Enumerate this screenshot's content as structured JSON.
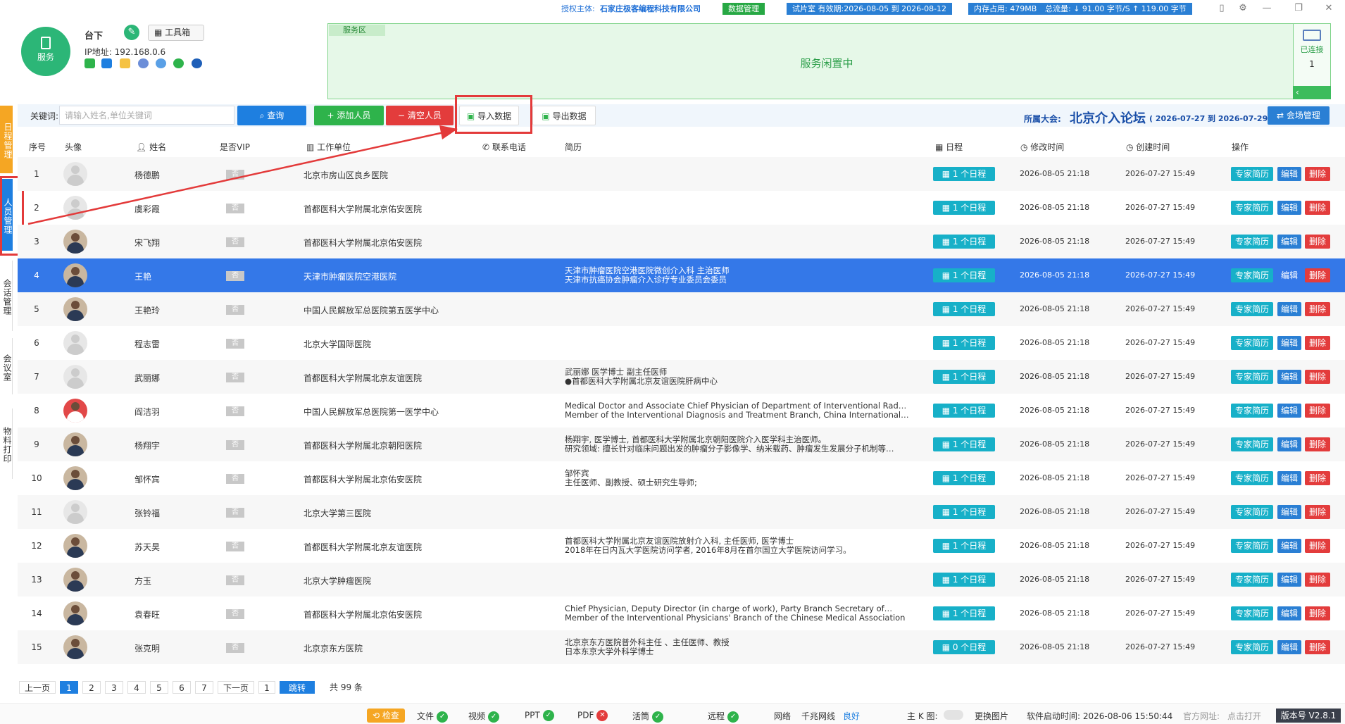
{
  "topbar": {
    "auth_label": "授权主体:",
    "company": "石家庄极客编程科技有限公司",
    "data_mgmt": "数据管理",
    "trial": "试片室 有效期:2026-08-05 到 2026-08-12",
    "memory": "内存占用: 479MB",
    "flow": "总流量: ↓ 91.00 字节/S   ↑ 119.00 字节"
  },
  "header": {
    "service_label": "服务",
    "user_name": "台下",
    "toolbox": "工具箱",
    "ip": "IP地址: 192.168.0.6",
    "service_area_tag": "服务区",
    "service_idle": "服务闲置中",
    "connected_label": "已连接",
    "connected_count": "1"
  },
  "sidebar": [
    {
      "label": "日程管理",
      "color": "#f5a623"
    },
    {
      "label": "人员管理",
      "color": "#1e7fe0"
    },
    {
      "label": "会话管理",
      "color": "#ffffff"
    },
    {
      "label": "会议室",
      "color": "#ffffff"
    },
    {
      "label": "物料打印",
      "color": "#ffffff"
    }
  ],
  "toolbar": {
    "keyword_label": "关键词:",
    "keyword_placeholder": "请输入姓名,单位关键词",
    "query": "查询",
    "add": "添加人员",
    "clear": "清空人员",
    "import": "导入数据",
    "export": "导出数据",
    "meeting_label": "所属大会:",
    "meeting_name": "北京介入论坛",
    "meeting_range": "( 2026-07-27 到 2026-07-29 )",
    "venue_mgmt": "会场管理"
  },
  "table": {
    "headers": [
      "序号",
      "头像",
      "姓名",
      "是否VIP",
      "工作单位",
      "联系电话",
      "简历",
      "日程",
      "修改时间",
      "创建时间",
      "操作"
    ],
    "rows": [
      {
        "idx": "1",
        "name": "杨德鹏",
        "vip": "否",
        "unit": "北京市房山区良乡医院",
        "resume": [
          "",
          ""
        ],
        "sched": "1 个日程",
        "mod": "2026-08-05 21:18",
        "cre": "2026-07-27 15:49",
        "avatar": "default"
      },
      {
        "idx": "2",
        "name": "虞彩霞",
        "vip": "否",
        "unit": "首都医科大学附属北京佑安医院",
        "resume": [
          "",
          ""
        ],
        "sched": "1 个日程",
        "mod": "2026-08-05 21:18",
        "cre": "2026-07-27 15:49",
        "avatar": "default"
      },
      {
        "idx": "3",
        "name": "宋飞翔",
        "vip": "否",
        "unit": "首都医科大学附属北京佑安医院",
        "resume": [
          "",
          ""
        ],
        "sched": "1 个日程",
        "mod": "2026-08-05 21:18",
        "cre": "2026-07-27 15:49",
        "avatar": "photo"
      },
      {
        "idx": "4",
        "name": "王艳",
        "vip": "否",
        "unit": "天津市肿瘤医院空港医院",
        "resume": [
          "天津市肿瘤医院空港医院微创介入科 主治医师",
          "天津市抗癌协会肿瘤介入诊疗专业委员会委员"
        ],
        "sched": "1 个日程",
        "mod": "2026-08-05 21:18",
        "cre": "2026-07-27 15:49",
        "avatar": "photo"
      },
      {
        "idx": "5",
        "name": "王艳玲",
        "vip": "否",
        "unit": "中国人民解放军总医院第五医学中心",
        "resume": [
          "",
          ""
        ],
        "sched": "1 个日程",
        "mod": "2026-08-05 21:18",
        "cre": "2026-07-27 15:49",
        "avatar": "photo"
      },
      {
        "idx": "6",
        "name": "程志雷",
        "vip": "否",
        "unit": "北京大学国际医院",
        "resume": [
          "",
          ""
        ],
        "sched": "1 个日程",
        "mod": "2026-08-05 21:18",
        "cre": "2026-07-27 15:49",
        "avatar": "default"
      },
      {
        "idx": "7",
        "name": "武丽娜",
        "vip": "否",
        "unit": "首都医科大学附属北京友谊医院",
        "resume": [
          "武丽娜 医学博士 副主任医师",
          "●首都医科大学附属北京友谊医院肝病中心"
        ],
        "sched": "1 个日程",
        "mod": "2026-08-05 21:18",
        "cre": "2026-07-27 15:49",
        "avatar": "default"
      },
      {
        "idx": "8",
        "name": "阎洁羽",
        "vip": "否",
        "unit": "中国人民解放军总医院第一医学中心",
        "resume": [
          "Medical Doctor and Associate Chief Physician of Department of Interventional Rad…",
          "Member of the Interventional Diagnosis and Treatment Branch, China International…"
        ],
        "sched": "1 个日程",
        "mod": "2026-08-05 21:18",
        "cre": "2026-07-27 15:49",
        "avatar": "red"
      },
      {
        "idx": "9",
        "name": "杨翔宇",
        "vip": "否",
        "unit": "首都医科大学附属北京朝阳医院",
        "resume": [
          "杨翔宇, 医学博士, 首都医科大学附属北京朝阳医院介入医学科主治医师。",
          "研究领域: 擅长针对临床问题出发的肿瘤分子影像学、纳米载药、肿瘤发生发展分子机制等…"
        ],
        "sched": "1 个日程",
        "mod": "2026-08-05 21:18",
        "cre": "2026-07-27 15:49",
        "avatar": "photo"
      },
      {
        "idx": "10",
        "name": "邹怀宾",
        "vip": "否",
        "unit": "首都医科大学附属北京佑安医院",
        "resume": [
          "邹怀宾",
          "主任医师、副教授、硕士研究生导师;"
        ],
        "sched": "1 个日程",
        "mod": "2026-08-05 21:18",
        "cre": "2026-07-27 15:49",
        "avatar": "photo"
      },
      {
        "idx": "11",
        "name": "张铃福",
        "vip": "否",
        "unit": "北京大学第三医院",
        "resume": [
          "",
          ""
        ],
        "sched": "1 个日程",
        "mod": "2026-08-05 21:18",
        "cre": "2026-07-27 15:49",
        "avatar": "default"
      },
      {
        "idx": "12",
        "name": "苏天昊",
        "vip": "否",
        "unit": "首都医科大学附属北京友谊医院",
        "resume": [
          "首都医科大学附属北京友谊医院放射介入科, 主任医师, 医学博士",
          "2018年在日内瓦大学医院访问学者, 2016年8月在首尔国立大学医院访问学习。"
        ],
        "sched": "1 个日程",
        "mod": "2026-08-05 21:18",
        "cre": "2026-07-27 15:49",
        "avatar": "photo"
      },
      {
        "idx": "13",
        "name": "方玉",
        "vip": "否",
        "unit": "北京大学肿瘤医院",
        "resume": [
          "",
          ""
        ],
        "sched": "1 个日程",
        "mod": "2026-08-05 21:18",
        "cre": "2026-07-27 15:49",
        "avatar": "photo"
      },
      {
        "idx": "14",
        "name": "袁春旺",
        "vip": "否",
        "unit": "首都医科大学附属北京佑安医院",
        "resume": [
          "Chief Physician, Deputy Director (in charge of work), Party Branch Secretary of…",
          "Member of the Interventional Physicians' Branch of the Chinese Medical Association"
        ],
        "sched": "1 个日程",
        "mod": "2026-08-05 21:18",
        "cre": "2026-07-27 15:49",
        "avatar": "photo"
      },
      {
        "idx": "15",
        "name": "张克明",
        "vip": "否",
        "unit": "北京京东方医院",
        "resume": [
          "北京京东方医院普外科主任 、主任医师、教授",
          "日本东京大学外科学博士"
        ],
        "sched": "0 个日程",
        "mod": "2026-08-05 21:18",
        "cre": "2026-07-27 15:49",
        "avatar": "photo"
      }
    ],
    "actions": {
      "profile": "专家简历",
      "edit": "编辑",
      "delete": "删除"
    }
  },
  "pagination": {
    "prev": "上一页",
    "pages": [
      "1",
      "2",
      "3",
      "4",
      "5",
      "6",
      "7"
    ],
    "current": "1",
    "next": "下一页",
    "jump_value": "1",
    "jump": "跳转",
    "total": "共 99 条"
  },
  "statusbar": {
    "check": "检查",
    "file": "文件",
    "video": "视频",
    "ppt": "PPT",
    "pdf": "PDF",
    "speech": "活筒",
    "remote": "远程",
    "network": "网络",
    "network_type": "千兆网线",
    "network_quality": "良好",
    "main_k": "主 K 图:",
    "change_image": "更换图片",
    "start_time": "软件启动时间: 2026-08-06 15:50:44",
    "website": "官方网址:",
    "open_link": "点击打开",
    "version": "版本号 V2.8.1"
  }
}
